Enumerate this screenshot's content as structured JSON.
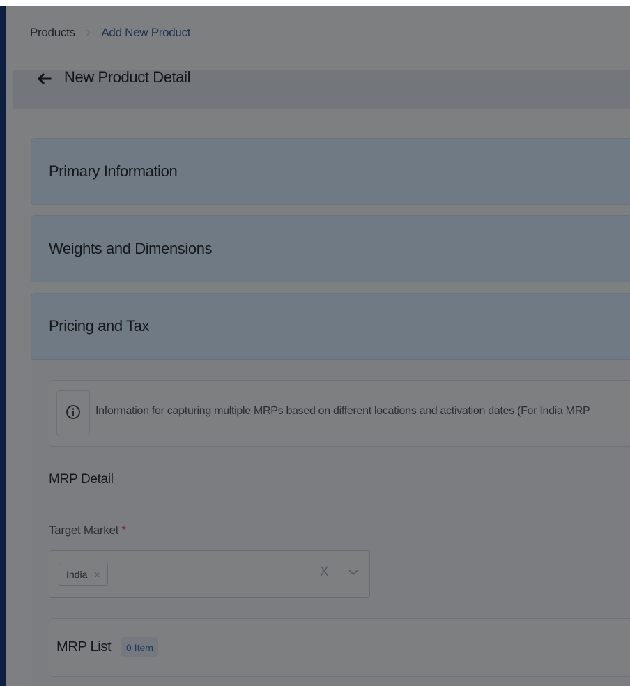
{
  "breadcrumb": {
    "root": "Products",
    "separator": "›",
    "current": "Add New Product"
  },
  "page": {
    "title": "New Product Detail"
  },
  "sections": {
    "primary": {
      "title": "Primary Information"
    },
    "weights": {
      "title": "Weights and Dimensions"
    },
    "pricing": {
      "title": "Pricing and Tax"
    }
  },
  "pricing": {
    "info_text": "Information for capturing multiple MRPs based on different locations and activation dates (For India MRP",
    "mrp_detail_title": "MRP Detail",
    "target_market": {
      "label": "Target Market",
      "required_mark": "*",
      "selected_tag": "India",
      "tag_remove": "×",
      "clear": "X"
    },
    "mrp_list": {
      "title": "MRP List",
      "count_badge": "0 Item"
    }
  },
  "icons": [
    "back-arrow-icon",
    "info-icon",
    "tag-remove-icon",
    "clear-icon",
    "chevron-down-icon"
  ]
}
